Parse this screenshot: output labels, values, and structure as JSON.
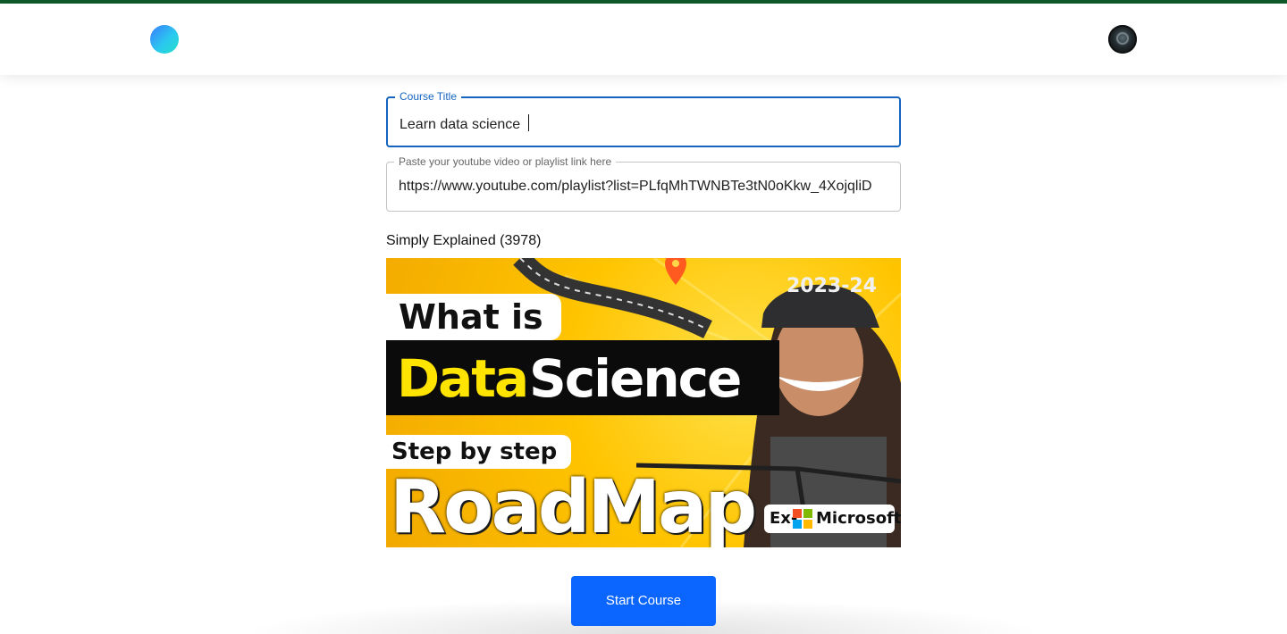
{
  "header": {
    "logo_icon": "gradient-circle-logo",
    "avatar_icon": "user-avatar",
    "accent_line_color": "#0f5a2a"
  },
  "form": {
    "course_title": {
      "label": "Course Title",
      "value": "Learn data science "
    },
    "playlist_link": {
      "label": "Paste your youtube video or playlist link here",
      "value": "https://www.youtube.com/playlist?list=PLfqMhTWNBTe3tN0oKkw_4XojqliD"
    }
  },
  "video": {
    "channel": "Simply Explained (3978)",
    "thumbnail": {
      "line1": "What is",
      "line2_highlight": "Data",
      "line2_rest": "Science",
      "line3": "Step by step",
      "line4": "RoadMap",
      "badge_year": "2023-24",
      "badge_prefix": "Ex-",
      "badge_brand": "Microsoft"
    }
  },
  "actions": {
    "start_label": "Start Course",
    "primary_color": "#0a66ff",
    "focus_color": "#1565c0"
  }
}
